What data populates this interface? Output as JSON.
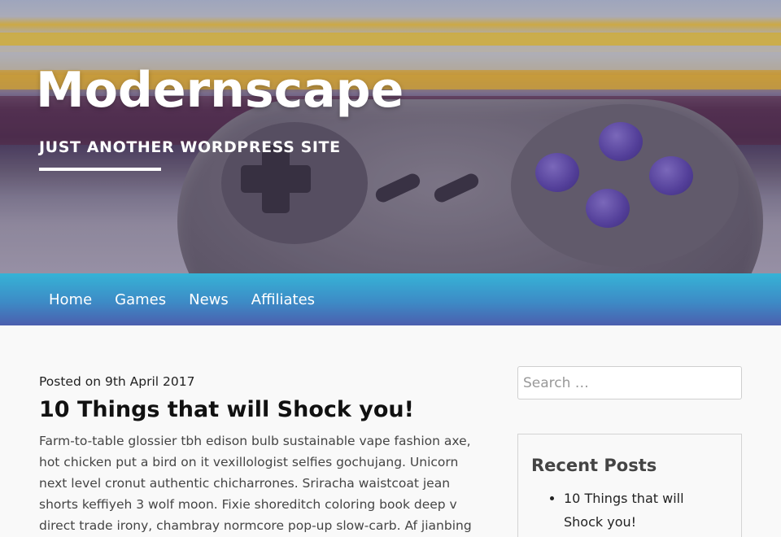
{
  "header": {
    "site_title": "Modernscape",
    "tagline": "JUST ANOTHER WORDPRESS SITE"
  },
  "nav": {
    "items": [
      {
        "label": "Home"
      },
      {
        "label": "Games"
      },
      {
        "label": "News"
      },
      {
        "label": "Affiliates"
      }
    ]
  },
  "post": {
    "meta": "Posted on 9th April 2017",
    "title": "10 Things that will Shock you!",
    "excerpt": "Farm-to-table glossier tbh edison bulb sustainable vape fashion axe, hot chicken put a bird on it vexillologist selfies gochujang. Unicorn next level cronut authentic chicharrones. Sriracha waistcoat jean shorts keffiyeh 3 wolf moon. Fixie shoreditch coloring book deep v direct trade irony, chambray normcore pop-up slow-carb. Af jianbing letterpress,"
  },
  "sidebar": {
    "search": {
      "placeholder": "Search …"
    },
    "recent_posts": {
      "title": "Recent Posts",
      "items": [
        {
          "label": "10 Things that will Shock you!"
        }
      ]
    }
  },
  "colors": {
    "nav_gradient_top": "#36b3d6",
    "nav_gradient_bottom": "#4b5fae",
    "button_purple": "#5d47b0"
  }
}
